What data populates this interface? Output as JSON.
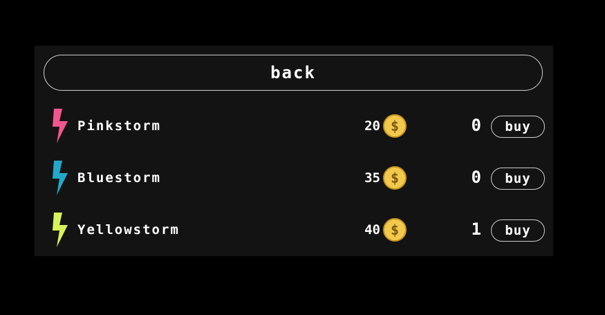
{
  "back_label": "back",
  "items": [
    {
      "name": "Pinkstorm",
      "price": "20",
      "owned": "0",
      "buy_label": "buy",
      "color": "#f2568f",
      "icon": "lightning-bolt"
    },
    {
      "name": "Bluestorm",
      "price": "35",
      "owned": "0",
      "buy_label": "buy",
      "color": "#22a9c9",
      "icon": "lightning-bolt"
    },
    {
      "name": "Yellowstorm",
      "price": "40",
      "owned": "1",
      "buy_label": "buy",
      "color": "#d6f25b",
      "icon": "lightning-bolt"
    }
  ],
  "currency_icon": "gold-coin",
  "colors": {
    "background": "#000000",
    "panel": "#131313",
    "border": "#cfcfcf",
    "coin": "#f2c94c",
    "coin_dark": "#c7941d"
  }
}
